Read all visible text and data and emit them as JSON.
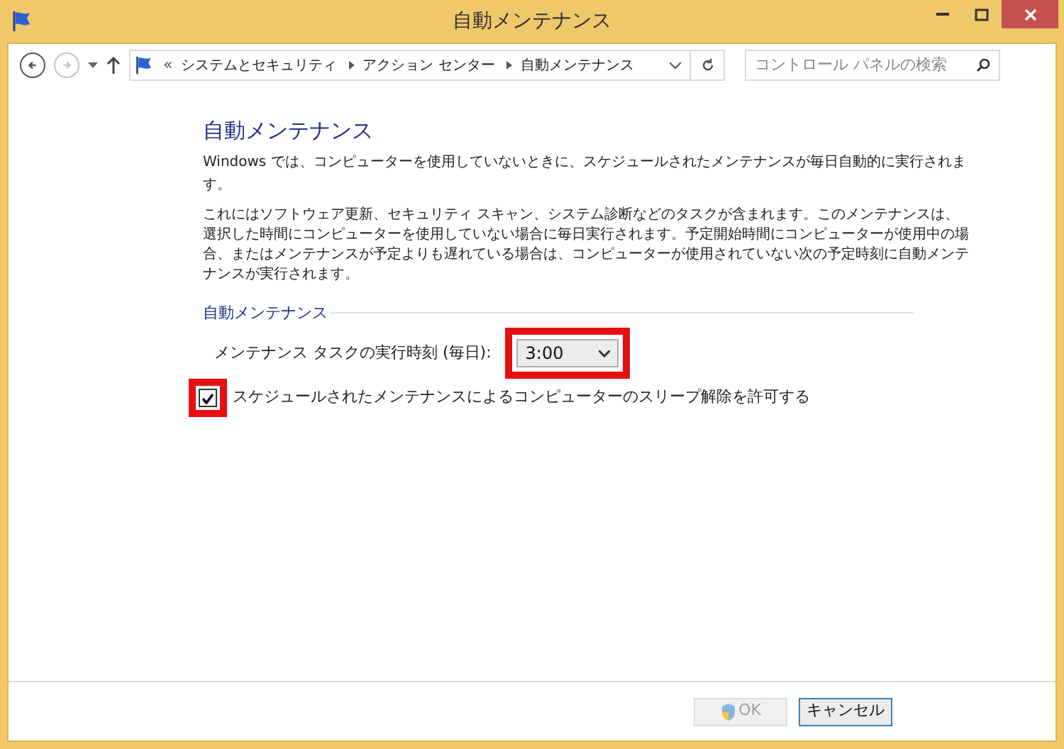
{
  "window": {
    "title": "自動メンテナンス"
  },
  "nav_buttons": [
    {
      "kind": "back",
      "disabled": false
    },
    {
      "kind": "forward",
      "disabled": true
    }
  ],
  "address_bar": {
    "overflow": "«",
    "crumbs": [
      "システムとセキュリティ",
      "アクション センター",
      "自動メンテナンス"
    ]
  },
  "search": {
    "placeholder": "コントロール パネルの検索"
  },
  "heading": "自動メンテナンス",
  "intro": "Windows では、コンピューターを使用していないときに、スケジュールされたメンテナンスが毎日自動的に実行されます。",
  "description": "これにはソフトウェア更新、セキュリティ スキャン、システム診断などのタスクが含まれます。このメンテナンスは、選択した時間にコンピューターを使用していない場合に毎日実行されます。予定開始時間にコンピューターが使用中の場合、またはメンテナンスが予定よりも遅れている場合は、コンピューターが使用されていない次の予定時刻に自動メンテナンスが実行されます。",
  "section": {
    "title": "自動メンテナンス",
    "time_label": "メンテナンス タスクの実行時刻 (毎日):",
    "time_value": "3:00",
    "time_highlighted": true,
    "wake": {
      "label": "スケジュールされたメンテナンスによるコンピューターのスリープ解除を許可する",
      "checked": true,
      "highlighted": true
    }
  },
  "buttons": [
    {
      "label": "OK",
      "disabled": true,
      "shield": true
    },
    {
      "label": "キャンセル",
      "disabled": false,
      "shield": false
    }
  ]
}
